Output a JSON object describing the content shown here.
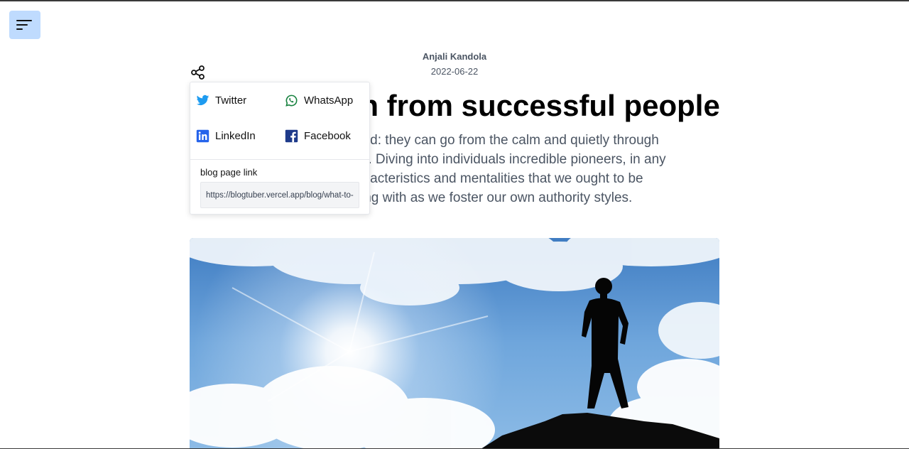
{
  "article": {
    "author": "Anjali Kandola",
    "date": "2022-06-22",
    "title": "What to learn from successful people",
    "summary": "Leaders are assorted: they can go from the calm and quietly through to the wild and flighty. Diving into individuals incredible pioneers, in any case, shows characteristics and mentalities that we ought to be generally dealing with as we foster our own authority styles.",
    "hero_image": "Silhouette of a man standing on a rock against a bright sunny sky with clouds"
  },
  "menu": {
    "icon": "hamburger-menu-icon"
  },
  "share": {
    "icon": "share-icon",
    "options": [
      {
        "label": "Twitter",
        "icon": "twitter-icon",
        "color": "#1d9bf0"
      },
      {
        "label": "WhatsApp",
        "icon": "whatsapp-icon",
        "color": "#15803d"
      },
      {
        "label": "LinkedIn",
        "icon": "linkedin-icon",
        "color": "#2563eb"
      },
      {
        "label": "Facebook",
        "icon": "facebook-icon",
        "color": "#1e3a8a"
      }
    ],
    "link_label": "blog page link",
    "link_value": "https://blogtuber.vercel.app/blog/what-to-learn-from-successful-people"
  },
  "colors": {
    "menu_button_bg": "#bfdbfe",
    "text_muted": "#4b5563"
  }
}
